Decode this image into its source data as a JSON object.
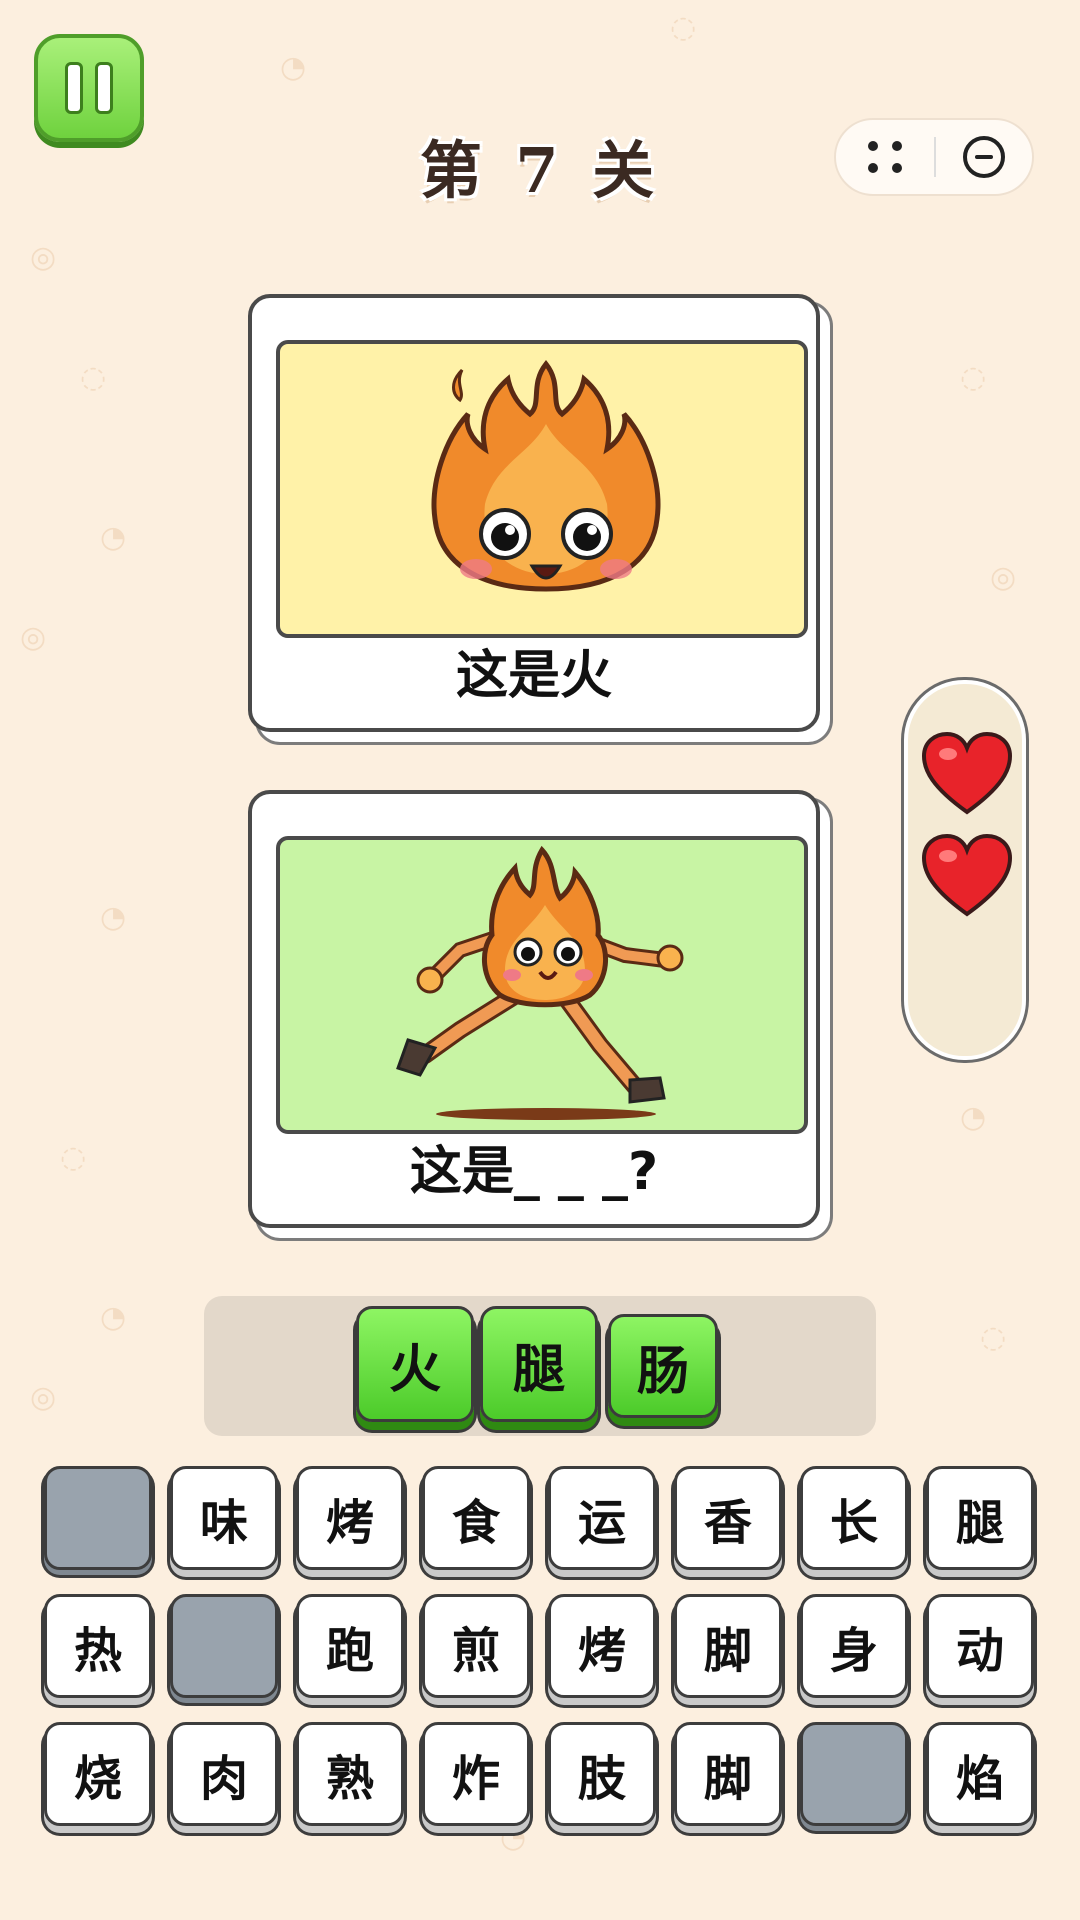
{
  "header": {
    "level_title": "第 7 关",
    "pause_icon": "pause-icon",
    "menu_icon": "more-dots-icon",
    "close_icon": "minimize-circle-icon"
  },
  "cards": [
    {
      "caption": "这是火",
      "image": "happy-fire-character",
      "bg_color": "#fff2a8"
    },
    {
      "caption": "这是_ _ _?",
      "image": "running-fire-character",
      "bg_color": "#c8f4a4"
    }
  ],
  "lives": {
    "count": 2,
    "icon": "heart-icon",
    "color": "#e8232a"
  },
  "answer": {
    "letters": [
      "火",
      "腿",
      "肠"
    ]
  },
  "letter_grid": [
    [
      "",
      "味",
      "烤",
      "食",
      "运",
      "香",
      "长",
      "腿"
    ],
    [
      "热",
      "",
      "跑",
      "煎",
      "烤",
      "脚",
      "身",
      "动"
    ],
    [
      "烧",
      "肉",
      "熟",
      "炸",
      "肢",
      "脚",
      "",
      "焰"
    ]
  ]
}
